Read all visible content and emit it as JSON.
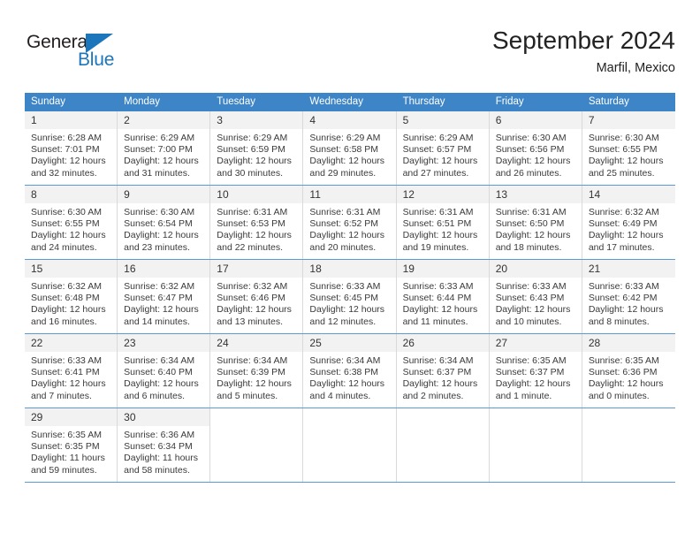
{
  "brand": {
    "name_part1": "General",
    "name_part2": "Blue",
    "triangle_icon": "blue-triangle-logo-mark",
    "colors": {
      "dark": "#231f20",
      "blue": "#1c76bc"
    }
  },
  "header": {
    "title": "September 2024",
    "subtitle": "Marfil, Mexico"
  },
  "theme": {
    "header_bg": "#3d85c6",
    "daynum_bg": "#f2f2f2",
    "row_divider": "#5b9bd5",
    "cell_divider": "#d9d9d9"
  },
  "weekday_headers": [
    "Sunday",
    "Monday",
    "Tuesday",
    "Wednesday",
    "Thursday",
    "Friday",
    "Saturday"
  ],
  "weeks": [
    [
      {
        "day": "1",
        "sunrise": "Sunrise: 6:28 AM",
        "sunset": "Sunset: 7:01 PM",
        "daylight1": "Daylight: 12 hours",
        "daylight2": "and 32 minutes."
      },
      {
        "day": "2",
        "sunrise": "Sunrise: 6:29 AM",
        "sunset": "Sunset: 7:00 PM",
        "daylight1": "Daylight: 12 hours",
        "daylight2": "and 31 minutes."
      },
      {
        "day": "3",
        "sunrise": "Sunrise: 6:29 AM",
        "sunset": "Sunset: 6:59 PM",
        "daylight1": "Daylight: 12 hours",
        "daylight2": "and 30 minutes."
      },
      {
        "day": "4",
        "sunrise": "Sunrise: 6:29 AM",
        "sunset": "Sunset: 6:58 PM",
        "daylight1": "Daylight: 12 hours",
        "daylight2": "and 29 minutes."
      },
      {
        "day": "5",
        "sunrise": "Sunrise: 6:29 AM",
        "sunset": "Sunset: 6:57 PM",
        "daylight1": "Daylight: 12 hours",
        "daylight2": "and 27 minutes."
      },
      {
        "day": "6",
        "sunrise": "Sunrise: 6:30 AM",
        "sunset": "Sunset: 6:56 PM",
        "daylight1": "Daylight: 12 hours",
        "daylight2": "and 26 minutes."
      },
      {
        "day": "7",
        "sunrise": "Sunrise: 6:30 AM",
        "sunset": "Sunset: 6:55 PM",
        "daylight1": "Daylight: 12 hours",
        "daylight2": "and 25 minutes."
      }
    ],
    [
      {
        "day": "8",
        "sunrise": "Sunrise: 6:30 AM",
        "sunset": "Sunset: 6:55 PM",
        "daylight1": "Daylight: 12 hours",
        "daylight2": "and 24 minutes."
      },
      {
        "day": "9",
        "sunrise": "Sunrise: 6:30 AM",
        "sunset": "Sunset: 6:54 PM",
        "daylight1": "Daylight: 12 hours",
        "daylight2": "and 23 minutes."
      },
      {
        "day": "10",
        "sunrise": "Sunrise: 6:31 AM",
        "sunset": "Sunset: 6:53 PM",
        "daylight1": "Daylight: 12 hours",
        "daylight2": "and 22 minutes."
      },
      {
        "day": "11",
        "sunrise": "Sunrise: 6:31 AM",
        "sunset": "Sunset: 6:52 PM",
        "daylight1": "Daylight: 12 hours",
        "daylight2": "and 20 minutes."
      },
      {
        "day": "12",
        "sunrise": "Sunrise: 6:31 AM",
        "sunset": "Sunset: 6:51 PM",
        "daylight1": "Daylight: 12 hours",
        "daylight2": "and 19 minutes."
      },
      {
        "day": "13",
        "sunrise": "Sunrise: 6:31 AM",
        "sunset": "Sunset: 6:50 PM",
        "daylight1": "Daylight: 12 hours",
        "daylight2": "and 18 minutes."
      },
      {
        "day": "14",
        "sunrise": "Sunrise: 6:32 AM",
        "sunset": "Sunset: 6:49 PM",
        "daylight1": "Daylight: 12 hours",
        "daylight2": "and 17 minutes."
      }
    ],
    [
      {
        "day": "15",
        "sunrise": "Sunrise: 6:32 AM",
        "sunset": "Sunset: 6:48 PM",
        "daylight1": "Daylight: 12 hours",
        "daylight2": "and 16 minutes."
      },
      {
        "day": "16",
        "sunrise": "Sunrise: 6:32 AM",
        "sunset": "Sunset: 6:47 PM",
        "daylight1": "Daylight: 12 hours",
        "daylight2": "and 14 minutes."
      },
      {
        "day": "17",
        "sunrise": "Sunrise: 6:32 AM",
        "sunset": "Sunset: 6:46 PM",
        "daylight1": "Daylight: 12 hours",
        "daylight2": "and 13 minutes."
      },
      {
        "day": "18",
        "sunrise": "Sunrise: 6:33 AM",
        "sunset": "Sunset: 6:45 PM",
        "daylight1": "Daylight: 12 hours",
        "daylight2": "and 12 minutes."
      },
      {
        "day": "19",
        "sunrise": "Sunrise: 6:33 AM",
        "sunset": "Sunset: 6:44 PM",
        "daylight1": "Daylight: 12 hours",
        "daylight2": "and 11 minutes."
      },
      {
        "day": "20",
        "sunrise": "Sunrise: 6:33 AM",
        "sunset": "Sunset: 6:43 PM",
        "daylight1": "Daylight: 12 hours",
        "daylight2": "and 10 minutes."
      },
      {
        "day": "21",
        "sunrise": "Sunrise: 6:33 AM",
        "sunset": "Sunset: 6:42 PM",
        "daylight1": "Daylight: 12 hours",
        "daylight2": "and 8 minutes."
      }
    ],
    [
      {
        "day": "22",
        "sunrise": "Sunrise: 6:33 AM",
        "sunset": "Sunset: 6:41 PM",
        "daylight1": "Daylight: 12 hours",
        "daylight2": "and 7 minutes."
      },
      {
        "day": "23",
        "sunrise": "Sunrise: 6:34 AM",
        "sunset": "Sunset: 6:40 PM",
        "daylight1": "Daylight: 12 hours",
        "daylight2": "and 6 minutes."
      },
      {
        "day": "24",
        "sunrise": "Sunrise: 6:34 AM",
        "sunset": "Sunset: 6:39 PM",
        "daylight1": "Daylight: 12 hours",
        "daylight2": "and 5 minutes."
      },
      {
        "day": "25",
        "sunrise": "Sunrise: 6:34 AM",
        "sunset": "Sunset: 6:38 PM",
        "daylight1": "Daylight: 12 hours",
        "daylight2": "and 4 minutes."
      },
      {
        "day": "26",
        "sunrise": "Sunrise: 6:34 AM",
        "sunset": "Sunset: 6:37 PM",
        "daylight1": "Daylight: 12 hours",
        "daylight2": "and 2 minutes."
      },
      {
        "day": "27",
        "sunrise": "Sunrise: 6:35 AM",
        "sunset": "Sunset: 6:37 PM",
        "daylight1": "Daylight: 12 hours",
        "daylight2": "and 1 minute."
      },
      {
        "day": "28",
        "sunrise": "Sunrise: 6:35 AM",
        "sunset": "Sunset: 6:36 PM",
        "daylight1": "Daylight: 12 hours",
        "daylight2": "and 0 minutes."
      }
    ],
    [
      {
        "day": "29",
        "sunrise": "Sunrise: 6:35 AM",
        "sunset": "Sunset: 6:35 PM",
        "daylight1": "Daylight: 11 hours",
        "daylight2": "and 59 minutes."
      },
      {
        "day": "30",
        "sunrise": "Sunrise: 6:36 AM",
        "sunset": "Sunset: 6:34 PM",
        "daylight1": "Daylight: 11 hours",
        "daylight2": "and 58 minutes."
      },
      {
        "day": "",
        "sunrise": "",
        "sunset": "",
        "daylight1": "",
        "daylight2": ""
      },
      {
        "day": "",
        "sunrise": "",
        "sunset": "",
        "daylight1": "",
        "daylight2": ""
      },
      {
        "day": "",
        "sunrise": "",
        "sunset": "",
        "daylight1": "",
        "daylight2": ""
      },
      {
        "day": "",
        "sunrise": "",
        "sunset": "",
        "daylight1": "",
        "daylight2": ""
      },
      {
        "day": "",
        "sunrise": "",
        "sunset": "",
        "daylight1": "",
        "daylight2": ""
      }
    ]
  ]
}
